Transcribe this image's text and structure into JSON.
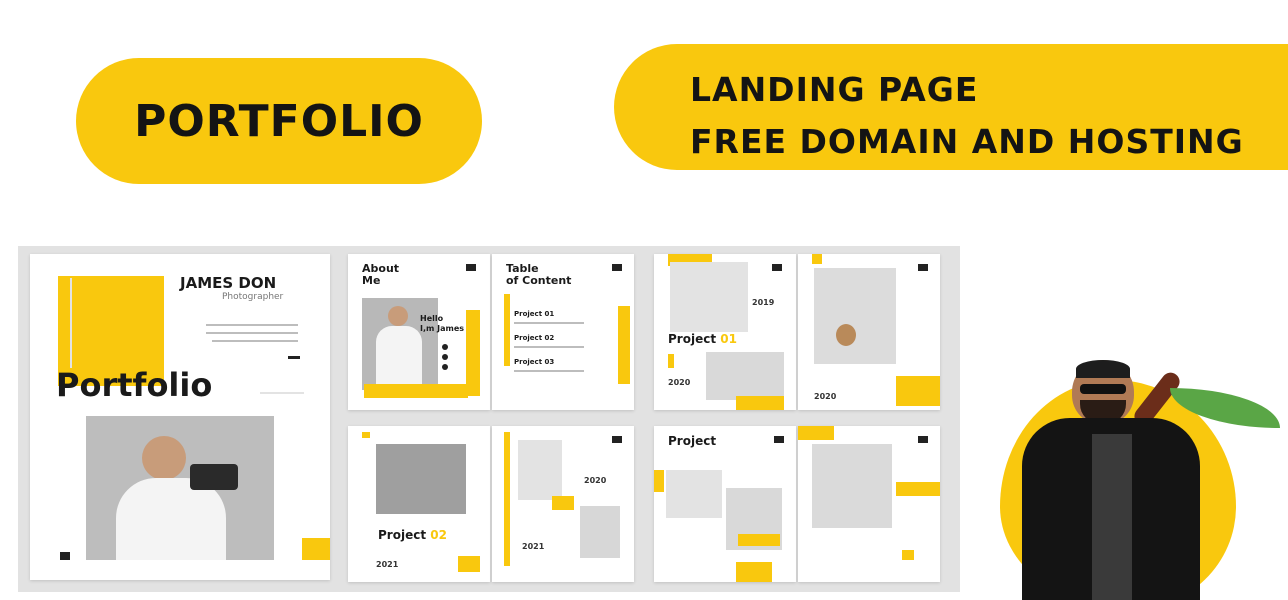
{
  "banner_left": {
    "label": "PORTFOLIO"
  },
  "banner_right": {
    "line1": "LANDING PAGE",
    "line2": "FREE DOMAIN AND HOSTING"
  },
  "mockup": {
    "cover": {
      "name": "JAMES DON",
      "role": "Photographer",
      "title": "Portfolio"
    },
    "about": {
      "heading_line1": "About",
      "heading_line2": "Me",
      "greeting_line1": "Hello",
      "greeting_line2": "I,m James"
    },
    "toc": {
      "heading_line1": "Table",
      "heading_line2": "of Content",
      "items": [
        "Project 01",
        "Project 02",
        "Project 03"
      ]
    },
    "project1": {
      "label": "Project",
      "num": "01",
      "year_a": "20",
      "year_b": "20"
    },
    "project2": {
      "label": "Project",
      "num": "02",
      "year_a": "20",
      "year_b": "21"
    },
    "project3": {
      "label": "Project"
    },
    "years": {
      "y1": "2019",
      "y2": "2020",
      "y3": "2020",
      "y4": "2021",
      "y5": "2020",
      "y6": "2021"
    }
  },
  "colors": {
    "accent": "#f9c80e",
    "stem": "#6b2d1a",
    "leaf": "#5aa646"
  }
}
